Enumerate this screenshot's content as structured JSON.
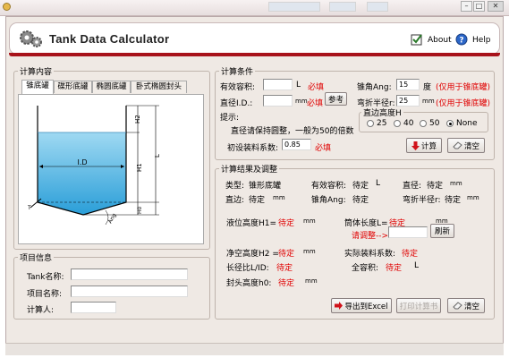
{
  "app": {
    "name": "Tank Data Calculator",
    "about": "About",
    "help": "Help"
  },
  "calc_content": {
    "legend": "计算内容",
    "tabs": [
      "锥底罐",
      "碟形底罐",
      "椭圆底罐",
      "卧式椭圆封头"
    ],
    "diagram": {
      "h1": "H1",
      "l": "L",
      "id": "I.D",
      "h2": "H2",
      "h0": "H0",
      "t": "T",
      "ang": "Ang"
    }
  },
  "project": {
    "legend": "项目信息",
    "tank_name_label": "Tank名称:",
    "project_name_label": "项目名称:",
    "calculator_label": "计算人:"
  },
  "conditions": {
    "legend": "计算条件",
    "volume_label": "有效容积:",
    "volume_unit": "L",
    "volume_req": "必填",
    "diameter_label": "直径I.D.:",
    "diameter_unit": "mm",
    "diameter_req": "必填",
    "ref_button": "参考",
    "hint_title": "提示:",
    "hint_text": "直径请保持圆整，一般为50的倍数",
    "initial_label": "初设装料系数:",
    "initial_value": "0.85",
    "initial_req": "必填",
    "cone_label": "锥角Ang:",
    "cone_value": "15",
    "cone_unit": "度",
    "cone_note": "(仅用于锥底罐)",
    "radius_label": "弯折半径r:",
    "radius_value": "25",
    "radius_unit": "mm",
    "radius_note": "(仅用于锥底罐)",
    "straight_legend": "直边高度H",
    "radio_options": [
      "25",
      "40",
      "50",
      "None"
    ],
    "radio_selected": "None",
    "calc_button": "计算",
    "clear_button": "清空"
  },
  "results": {
    "legend": "计算结果及调整",
    "type_label": "类型:",
    "type_value": "锥形底罐",
    "eff_vol_label": "有效容积:",
    "eff_vol_value": "待定",
    "eff_vol_unit": "L",
    "dia_label": "直径:",
    "dia_value": "待定",
    "dia_unit": "mm",
    "straight_label": "直边:",
    "straight_value": "待定",
    "straight_unit": "mm",
    "cone_label": "锥角Ang:",
    "cone_value": "待定",
    "bend_label": "弯折半径r:",
    "bend_value": "待定",
    "bend_unit": "mm",
    "liquid_label": "液位高度H1=",
    "liquid_value": "待定",
    "liquid_unit": "mm",
    "shell_label": "筒体长度L=",
    "shell_value": "待定",
    "shell_unit": "mm",
    "adjust_label": "请调整-->",
    "refresh_button": "刷新",
    "headspace_label": "净空高度H2 =",
    "headspace_value": "待定",
    "headspace_unit": "mm",
    "fill_label": "实际装料系数:",
    "fill_value": "待定",
    "ratio_label": "长径比L/ID:",
    "ratio_value": "待定",
    "total_label": "全容积:",
    "total_value": "待定",
    "total_unit": "L",
    "head_label": "封头高度h0:",
    "head_value": "待定",
    "head_unit": "mm",
    "export_button": "导出到Excel",
    "print_button": "打印计算书",
    "clear_button": "清空"
  }
}
